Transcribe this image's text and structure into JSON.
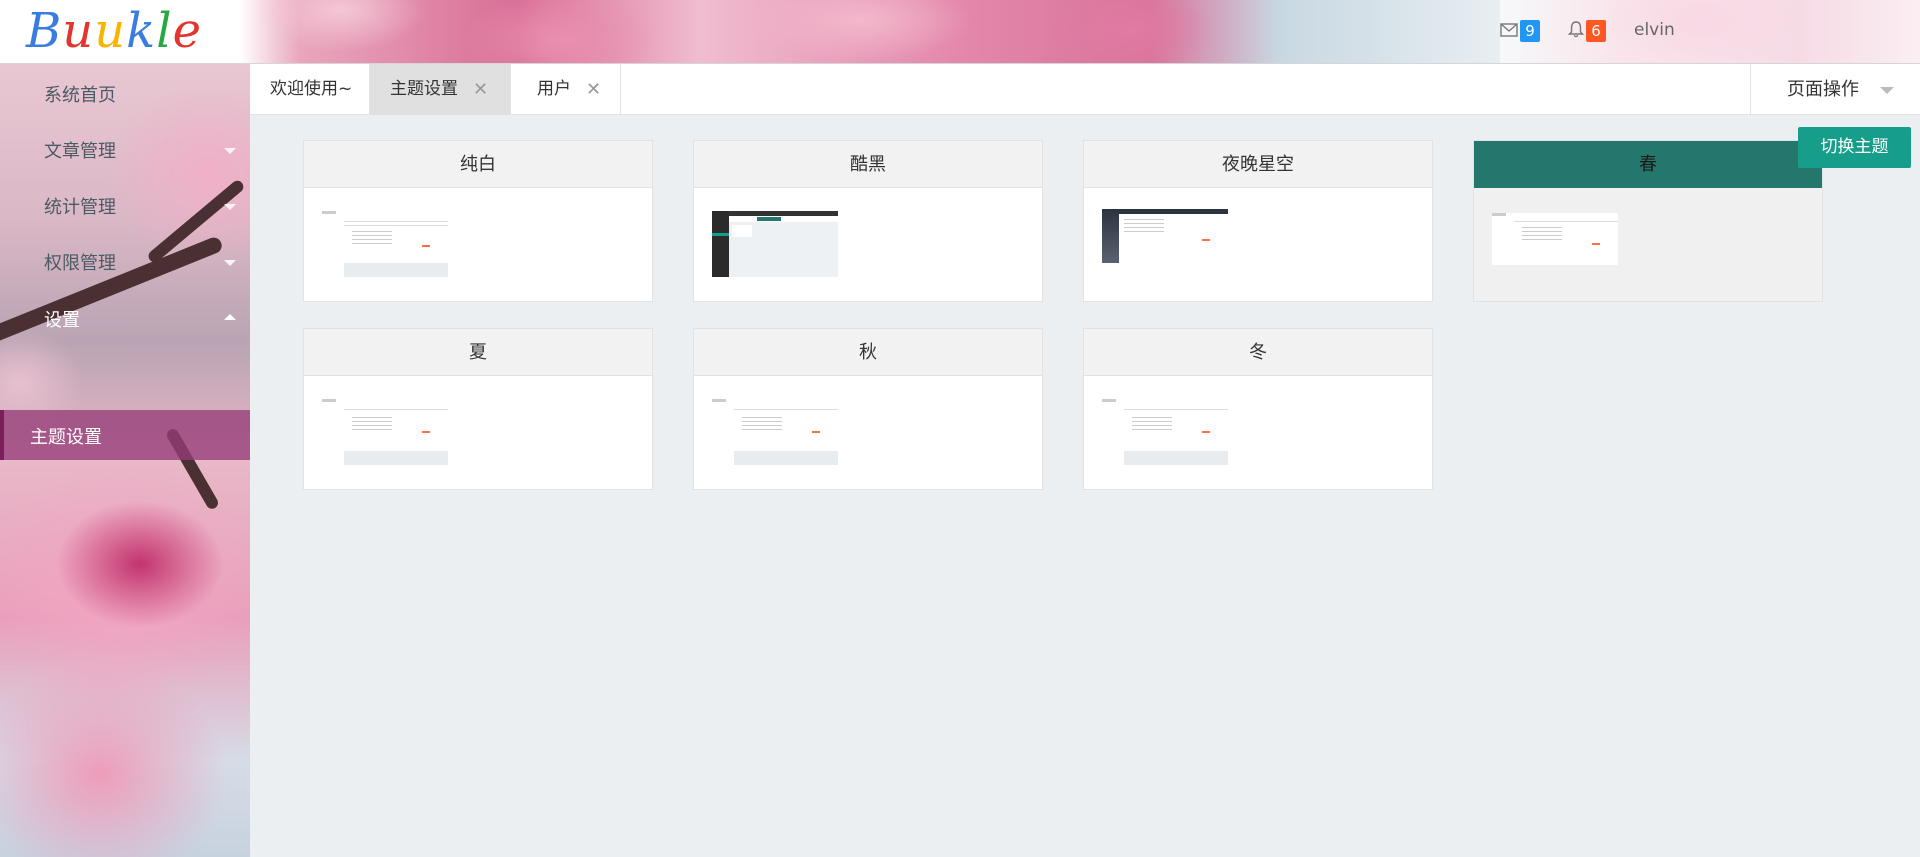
{
  "header": {
    "logo": [
      "B",
      "u",
      "u",
      "k",
      "l",
      "e"
    ],
    "logo_colors": [
      "#3a7de0",
      "#e3342f",
      "#f7b500",
      "#3a7de0",
      "#28a745",
      "#e3342f"
    ],
    "mail_count": "9",
    "notice_count": "6",
    "username": "elvin",
    "mail_badge_color": "#2196f3",
    "notice_badge_color": "#ff5722"
  },
  "sidebar": {
    "items": [
      {
        "label": "系统首页"
      },
      {
        "label": "文章管理"
      },
      {
        "label": "统计管理"
      },
      {
        "label": "权限管理"
      },
      {
        "label": "设置"
      }
    ],
    "active_item": "主题设置"
  },
  "tabs": [
    {
      "label": "欢迎使用~",
      "closable": false
    },
    {
      "label": "主题设置",
      "closable": true
    },
    {
      "label": "用户",
      "closable": true
    }
  ],
  "tab_close_glyph": "✕",
  "page_ops_label": "页面操作",
  "switch_theme_label": "切换主题",
  "themes": [
    {
      "name": "纯白",
      "style": "light"
    },
    {
      "name": "酷黑",
      "style": "dark"
    },
    {
      "name": "夜晚星空",
      "style": "night"
    },
    {
      "name": "春",
      "style": "light",
      "active": true
    },
    {
      "name": "夏",
      "style": "light"
    },
    {
      "name": "秋",
      "style": "light"
    },
    {
      "name": "冬",
      "style": "light"
    }
  ],
  "accent_color": "#179e8b"
}
